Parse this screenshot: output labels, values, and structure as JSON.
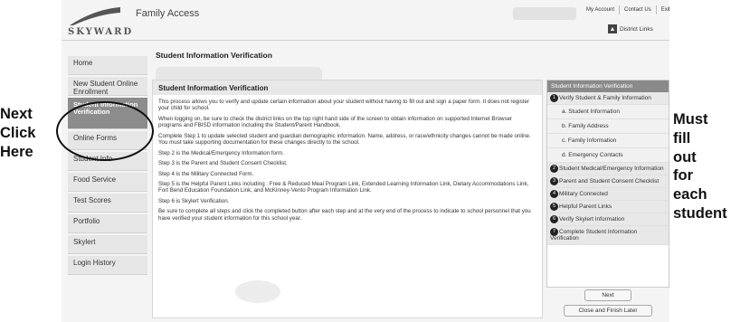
{
  "header": {
    "logo_text": "SKYWARD",
    "app_title": "Family Access",
    "top_links": [
      "My Account",
      "Contact Us",
      "Exit"
    ],
    "district_links": "District Links"
  },
  "sidebar": {
    "items": [
      {
        "label": "Home"
      },
      {
        "label": "New Student Online Enrollment"
      },
      {
        "label": "Student Information Verification",
        "active": true
      },
      {
        "label": "Online Forms"
      },
      {
        "label": "Student Info"
      },
      {
        "label": "Food Service"
      },
      {
        "label": "Test Scores"
      },
      {
        "label": "Portfolio"
      },
      {
        "label": "Skylert"
      },
      {
        "label": "Login History"
      }
    ]
  },
  "main": {
    "title": "Student Information Verification",
    "box_title": "Student Information Verification",
    "paragraphs": [
      "This process allows you to verify and update certain information about your student without having to fill out and sign a paper form. It does not register your child for school.",
      "When logging on, be sure to check the district links on the top right hand side of the screen to obtain information on supported Internet Browser programs and FBISD information including the Student/Parent Handbook.",
      "Complete Step 1 to update selected student and guardian demographic information. Name, address, or race/ethnicity changes cannot be made online. You must take supporting documentation for these changes directly to the school.",
      "Step 2 is the Medical/Emergency Information form.",
      "Step 3 is the Parent and Student Consent Checklist.",
      "Step 4 is the Military Connected Form.",
      "Step 5 is the Helpful Parent Links including : Free & Reduced Meal Program Link, Extended Learning Information Link, Dietary Accommodations Link, Fort Bend Education Foundation Link, and McKinney-Vento Program Information Link.",
      "Step 6 is Skylert Verification.",
      "Be sure to complete all steps and click the completed button after each step and at the very end of the process to indicate to school personnel that you have verified your student information for this school year."
    ]
  },
  "steps": {
    "header": "Student Information Verification",
    "items": [
      {
        "num": "1",
        "label": "Verify Student & Family Information"
      },
      {
        "sub": "a. Student Information"
      },
      {
        "sub": "b. Family Address"
      },
      {
        "sub": "c. Family Information"
      },
      {
        "sub": "d. Emergency Contacts"
      },
      {
        "num": "2",
        "label": "Student Medical/Emergency Information"
      },
      {
        "num": "3",
        "label": "Parent and Student Consent Checklist"
      },
      {
        "num": "4",
        "label": "Military Connected"
      },
      {
        "num": "5",
        "label": "Helpful Parent Links"
      },
      {
        "num": "6",
        "label": "Verify Skylert Information"
      },
      {
        "num": "7",
        "label": "Complete Student Information Verification"
      }
    ],
    "next_label": "Next",
    "finish_label": "Close and Finish Later"
  },
  "annotations": {
    "left": [
      "Next",
      "Click",
      "Here"
    ],
    "right": [
      "Must",
      "fill",
      "out",
      "for",
      "each",
      "student"
    ]
  }
}
